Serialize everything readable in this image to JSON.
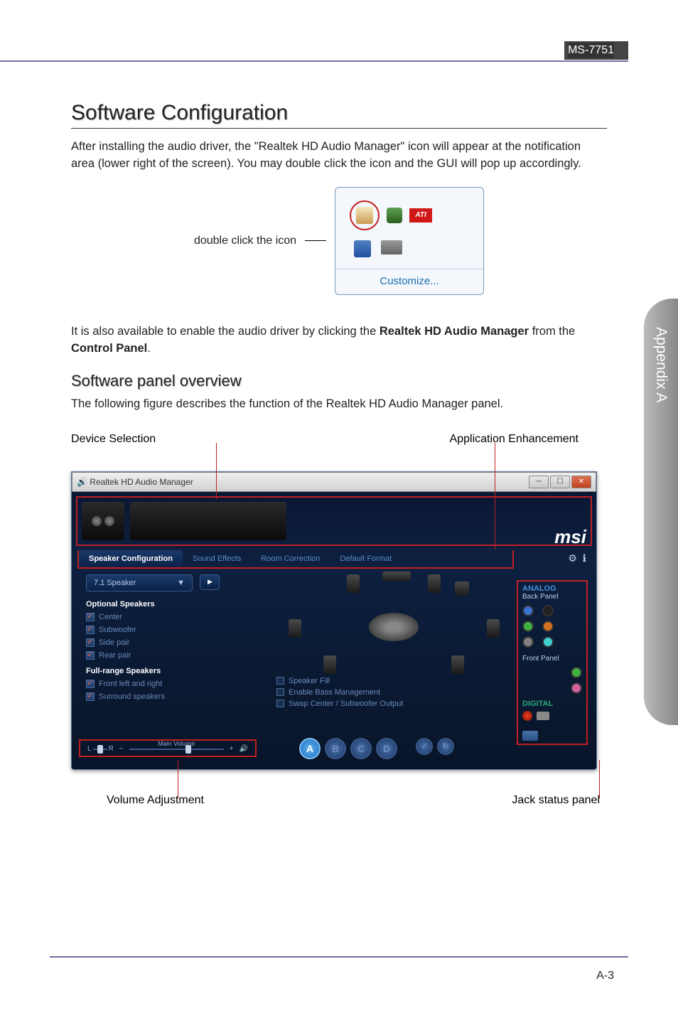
{
  "header": {
    "model": "MS-7751"
  },
  "h1": "Software Configuration",
  "intro": "After installing the audio driver, the \"Realtek HD Audio Manager\" icon will appear at the notification area (lower right of the screen). You may double click the icon and the GUI will pop up accordingly.",
  "tray": {
    "label": "double click the icon",
    "ati": "ATI",
    "customize": "Customize..."
  },
  "para2_pre": "It is also available to enable the audio driver by clicking the ",
  "para2_bold1": "Realtek HD Audio Manager",
  "para2_mid": " from the ",
  "para2_bold2": "Control Panel",
  "para2_post": ".",
  "h2": "Software panel overview",
  "para3": "The following figure describes the function of the Realtek HD Audio Manager panel.",
  "callouts": {
    "device_selection": "Device Selection",
    "app_enhancement": "Application Enhancement",
    "volume_adjustment": "Volume Adjustment",
    "jack_status": "Jack status panel"
  },
  "panel": {
    "title": "Realtek HD Audio Manager",
    "brand": "msi",
    "tabs": [
      "Speaker Configuration",
      "Sound Effects",
      "Room Correction",
      "Default Format"
    ],
    "analog_label": "ANALOG",
    "back_panel": "Back Panel",
    "front_panel": "Front Panel",
    "digital_label": "DIGITAL",
    "speaker_mode": "7.1 Speaker",
    "optional_hdr": "Optional Speakers",
    "optional": [
      "Center",
      "Subwoofer",
      "Side pair",
      "Rear pair"
    ],
    "fullrange_hdr": "Full-range Speakers",
    "fullrange": [
      "Front left and right",
      "Surround speakers"
    ],
    "center_opts": [
      "Speaker Fill",
      "Enable Bass Management",
      "Swap Center / Subwoofer Output"
    ],
    "main_volume": "Main Volume",
    "lr": {
      "l": "L",
      "r": "R"
    },
    "thx": [
      "A",
      "B",
      "C",
      "D"
    ]
  },
  "side_tab": "Appendix A",
  "footer": "A-3"
}
